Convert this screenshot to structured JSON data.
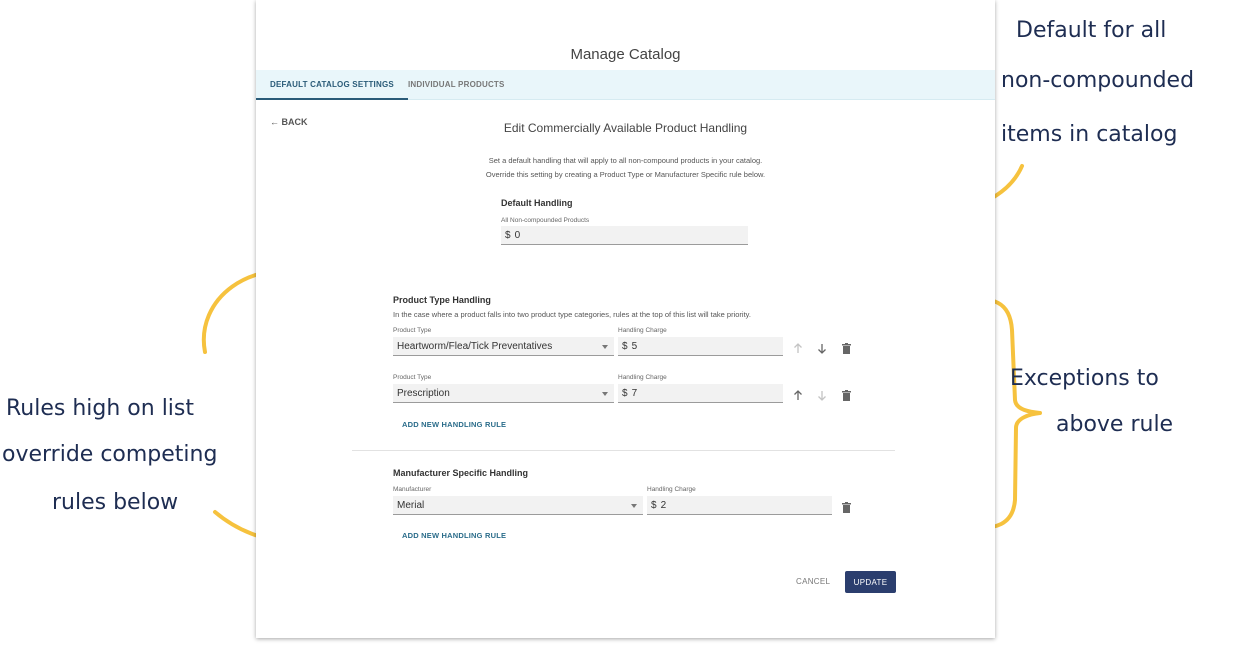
{
  "card": {
    "title": "Manage Catalog",
    "tabs": [
      {
        "label": "DEFAULT CATALOG SETTINGS",
        "active": true
      },
      {
        "label": "INDIVIDUAL PRODUCTS",
        "active": false
      }
    ],
    "back_label": "← BACK",
    "heading": "Edit Commercially Available Product Handling",
    "description": [
      "Set a default handling that will apply to all non-compound products in your catalog.",
      "Override this setting by creating a Product Type or Manufacturer Specific rule below."
    ]
  },
  "default_handling": {
    "title": "Default Handling",
    "field_label": "All Non-compounded Products",
    "currency": "$",
    "value": "0"
  },
  "product_type_handling": {
    "title": "Product Type Handling",
    "description": "In the case where a product falls into two product type categories, rules at the top of this list will take priority.",
    "rules": [
      {
        "type_label": "Product Type",
        "type_value": "Heartworm/Flea/Tick Preventatives",
        "charge_label": "Handling Charge",
        "currency": "$",
        "charge_value": "5"
      },
      {
        "type_label": "Product Type",
        "type_value": "Prescription",
        "charge_label": "Handling Charge",
        "currency": "$",
        "charge_value": "7"
      }
    ],
    "add_label": "ADD NEW HANDLING RULE"
  },
  "manufacturer_handling": {
    "title": "Manufacturer Specific Handling",
    "rules": [
      {
        "manufacturer_label": "Manufacturer",
        "manufacturer_value": "Merial",
        "charge_label": "Handling Charge",
        "currency": "$",
        "charge_value": "2"
      }
    ],
    "add_label": "ADD NEW HANDLING RULE"
  },
  "footer": {
    "cancel_label": "CANCEL",
    "update_label": "UPDATE"
  },
  "annotations": {
    "top_right": [
      "Default for all",
      "non-compounded",
      "items in catalog"
    ],
    "right": [
      "Exceptions to",
      "above rule"
    ],
    "left": [
      "Rules high on list",
      "override competing",
      "rules below"
    ]
  },
  "colors": {
    "accent": "#2a5b78",
    "primary_button": "#2b3e6e",
    "annotation_arrow": "#f6c23e",
    "annotation_text": "#1e2d52"
  },
  "icons": {
    "move_up": "arrow-up-icon",
    "move_down": "arrow-down-icon",
    "delete": "trash-icon",
    "dropdown": "chevron-down-icon"
  }
}
